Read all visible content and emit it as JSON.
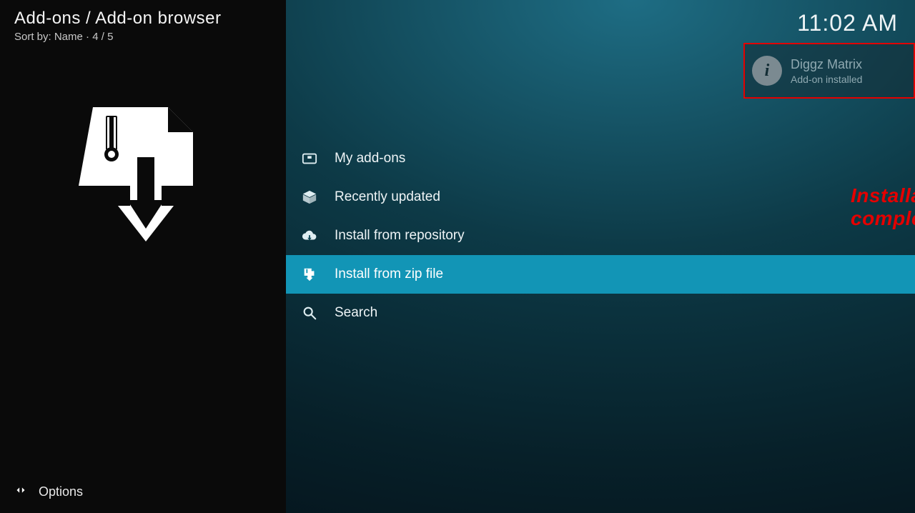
{
  "header": {
    "breadcrumb": "Add-ons / Add-on browser",
    "sort_prefix": "Sort by: Name",
    "sort_sep": "  ·  ",
    "sort_count": "4 / 5"
  },
  "clock": "11:02 AM",
  "menu": {
    "items": [
      {
        "id": "my-addons",
        "label": "My add-ons",
        "icon": "addons-icon",
        "selected": false
      },
      {
        "id": "recent",
        "label": "Recently updated",
        "icon": "box-icon",
        "selected": false
      },
      {
        "id": "install-repo",
        "label": "Install from repository",
        "icon": "cloud-icon",
        "selected": false
      },
      {
        "id": "install-zip",
        "label": "Install from zip file",
        "icon": "zip-icon",
        "selected": true
      },
      {
        "id": "search",
        "label": "Search",
        "icon": "search-icon",
        "selected": false
      }
    ]
  },
  "notification": {
    "title": "Diggz Matrix",
    "subtitle": "Add-on installed"
  },
  "annotation": {
    "text": "Installation complete!",
    "color": "#e40000"
  },
  "footer": {
    "options_label": "Options"
  }
}
